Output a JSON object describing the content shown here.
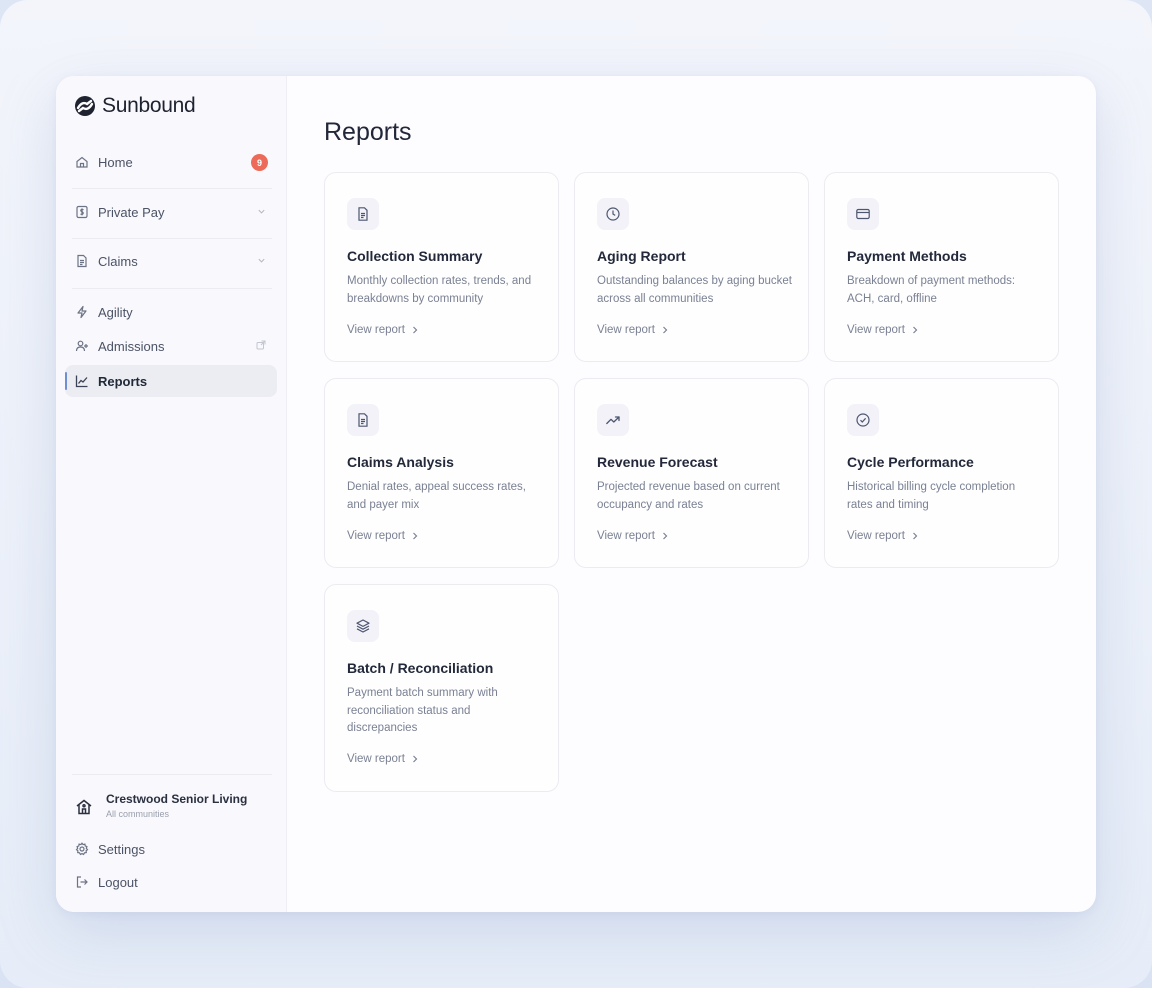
{
  "app": {
    "brand": "Sunbound"
  },
  "sidebar": {
    "items": [
      {
        "label": "Home",
        "icon": "home-icon",
        "badge": "9"
      },
      {
        "label": "Private Pay",
        "icon": "dollar-doc-icon"
      },
      {
        "label": "Claims",
        "icon": "document-icon"
      },
      {
        "label": "Agility",
        "icon": "bolt-icon"
      },
      {
        "label": "Admissions",
        "icon": "user-plus-icon"
      },
      {
        "label": "Reports",
        "icon": "chart-line-icon",
        "active": true
      }
    ],
    "org": {
      "name": "Crestwood Senior Living",
      "sub": "All communities"
    },
    "settings_label": "Settings",
    "logout_label": "Logout"
  },
  "main": {
    "title": "Reports",
    "cards": [
      {
        "title": "Collection Summary",
        "desc": "Monthly collection rates, trends, and breakdowns by community",
        "link": "View report",
        "icon": "document-icon"
      },
      {
        "title": "Aging Report",
        "desc": "Outstanding balances by aging bucket across all communities",
        "link": "View report",
        "icon": "clock-icon"
      },
      {
        "title": "Payment Methods",
        "desc": "Breakdown of payment methods: ACH, card, offline",
        "link": "View report",
        "icon": "credit-card-icon"
      },
      {
        "title": "Claims Analysis",
        "desc": "Denial rates, appeal success rates, and payer mix",
        "link": "View report",
        "icon": "document-icon"
      },
      {
        "title": "Revenue Forecast",
        "desc": "Projected revenue based on current occupancy and rates",
        "link": "View report",
        "icon": "trending-up-icon"
      },
      {
        "title": "Cycle Performance",
        "desc": "Historical billing cycle completion rates and timing",
        "link": "View report",
        "icon": "check-circle-icon"
      },
      {
        "title": "Batch / Reconciliation",
        "desc": "Payment batch summary with reconciliation status and discrepancies",
        "link": "View report",
        "icon": "layers-icon"
      }
    ]
  },
  "colors": {
    "accent": "#6d8fd6",
    "badge": "#ec6a5a"
  }
}
